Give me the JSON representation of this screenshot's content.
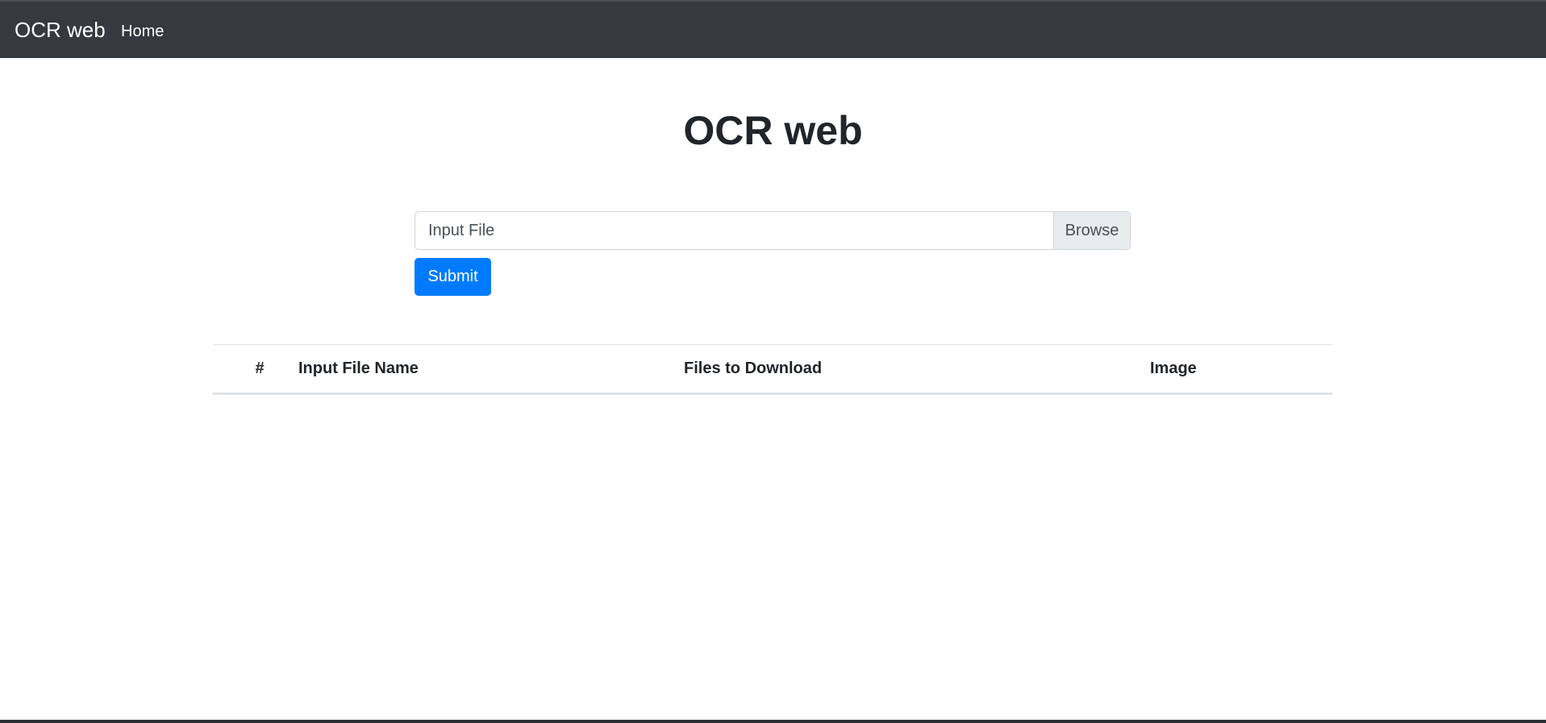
{
  "navbar": {
    "brand": "OCR web",
    "links": [
      {
        "label": "Home"
      }
    ]
  },
  "main": {
    "title": "OCR web",
    "upload": {
      "file_label": "Input File",
      "browse_label": "Browse",
      "submit_label": "Submit"
    },
    "table": {
      "columns": [
        "#",
        "Input File Name",
        "Files to Download",
        "Image"
      ],
      "rows": []
    }
  },
  "colors": {
    "navbar_bg": "#343a40",
    "primary": "#007bff",
    "browse_bg": "#e9ecef",
    "text": "#212529"
  }
}
